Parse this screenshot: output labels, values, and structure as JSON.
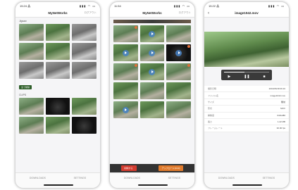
{
  "phone1": {
    "status": {
      "time": "15:24 ⁂",
      "icons": "▮▮▮ ◠ ▭"
    },
    "nav": {
      "title": "MyNetWorks",
      "right": "ログアウト"
    },
    "section1": "Jigsaw",
    "chip": "全て削除",
    "section2": "CLIPS",
    "tabs": [
      "DOWNLOADS",
      "SETTINGS"
    ]
  },
  "phone2": {
    "status": {
      "time": "11:54",
      "icons": "▮▮▮ ◠ ▭"
    },
    "nav": {
      "title": "MyNetWorks",
      "right": "ログアウト"
    },
    "actions": {
      "delete": "削除する",
      "upload": "アップロード(1/10)"
    },
    "tabs": [
      "DOWNLOADS",
      "SETTINGS"
    ]
  },
  "phone3": {
    "status": {
      "time": "15:22 ⁂",
      "icons": "▮▮▮ ◠ ▭"
    },
    "nav": {
      "back": "‹",
      "title": "image1042.mov"
    },
    "player": {
      "progress": 0.45,
      "play": "▶",
      "pause": "❚❚",
      "stop": "■"
    },
    "info": [
      {
        "k": "撮影日時",
        "v": "2019/06/18 06:10"
      },
      {
        "k": "ファイル名",
        "v": "image1042.mov"
      },
      {
        "k": "サイズ",
        "v": "無効"
      },
      {
        "k": "形式",
        "v": "MOV"
      },
      {
        "k": "解像度",
        "v": "640x480"
      },
      {
        "k": "長さ",
        "v": "1.22 MB"
      },
      {
        "k": "フレームレート",
        "v": "30.00 fps"
      }
    ],
    "tabs": [
      "DOWNLOADS",
      "SETTINGS"
    ]
  }
}
